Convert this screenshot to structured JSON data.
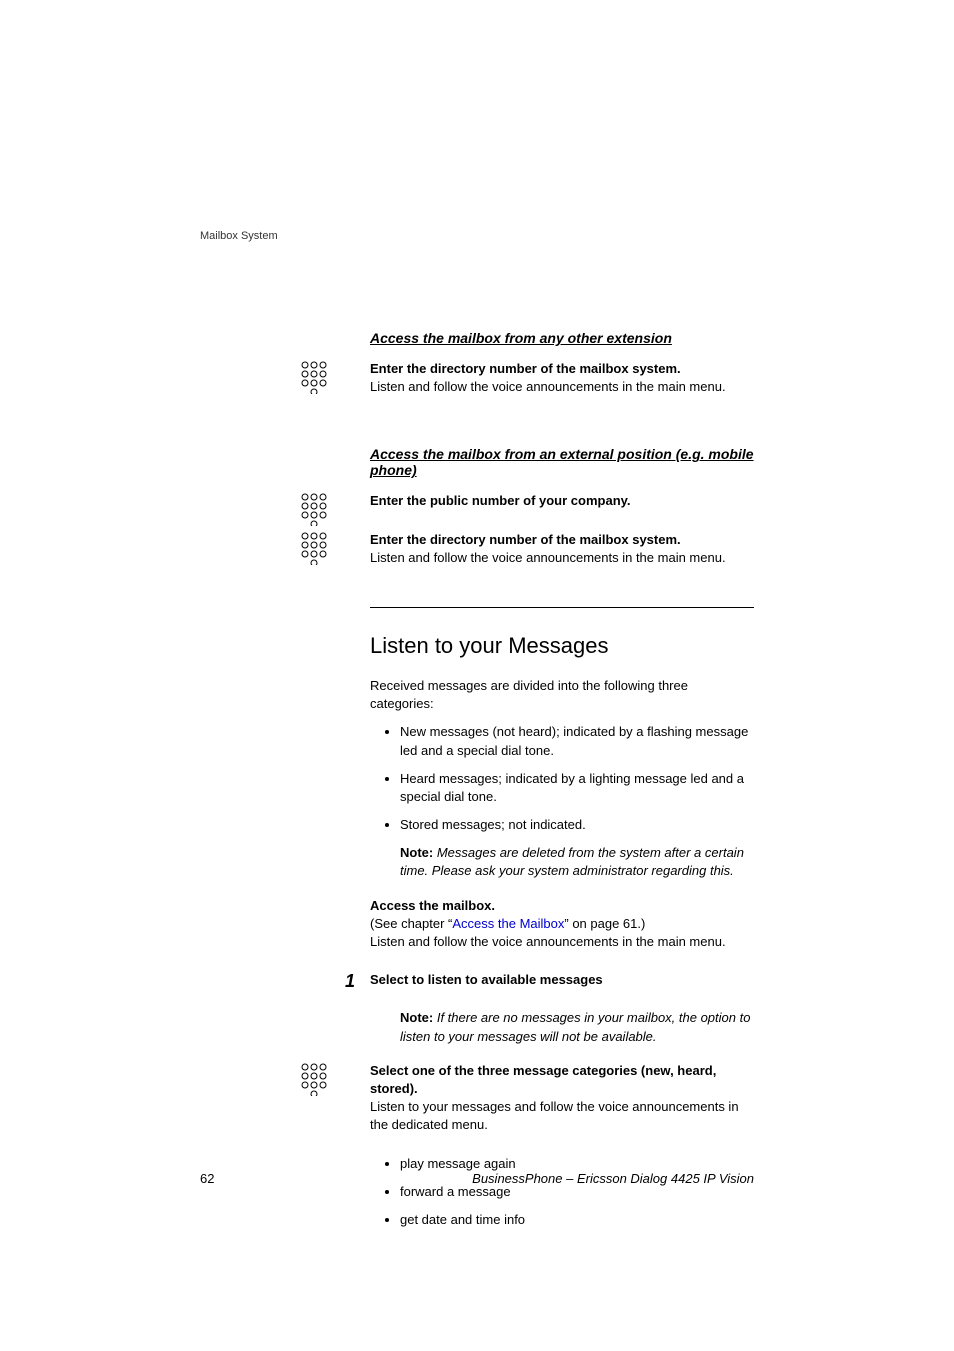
{
  "header": {
    "label": "Mailbox System"
  },
  "section1": {
    "title": "Access the mailbox from any other extension",
    "block1": {
      "bold": "Enter the directory number of the mailbox system.",
      "body": "Listen and follow the voice announcements in the main menu."
    }
  },
  "section2": {
    "title": "Access the mailbox from an external position (e.g. mobile phone)",
    "block1": {
      "bold": "Enter the public number of your company."
    },
    "block2": {
      "bold": "Enter the directory number of the mailbox system.",
      "body": "Listen and follow the voice announcements in the main menu."
    }
  },
  "listen": {
    "heading": "Listen to your Messages",
    "intro": "Received messages are divided into the following three categories:",
    "categories": [
      "New messages (not heard); indicated by a flashing message led and a special dial tone.",
      "Heard messages; indicated by a lighting message led and a special dial tone.",
      "Stored messages; not indicated."
    ],
    "note1": {
      "label": "Note:",
      "body": " Messages are deleted from the system after a certain time. Please ask your system administrator regarding this."
    },
    "access": {
      "bold": "Access the mailbox.",
      "pre": "(See chapter “",
      "link": "Access the Mailbox",
      "post": "” on page 61.)",
      "body2": "Listen and follow the voice announcements in the main menu."
    },
    "step1": {
      "num": "1",
      "bold": "Select to listen to available messages"
    },
    "note2": {
      "label": "Note:",
      "body": " If there are no messages in your mailbox, the option to listen to your messages will not be available."
    },
    "select": {
      "bold": "Select one of the three message categories (new, heard, stored).",
      "body": "Listen to your messages and follow the voice announcements in the dedicated menu."
    },
    "actions": [
      "play message again",
      "forward a message",
      "get date and time info"
    ]
  },
  "footer": {
    "page": "62",
    "product": "BusinessPhone – Ericsson Dialog 4425 IP Vision"
  }
}
